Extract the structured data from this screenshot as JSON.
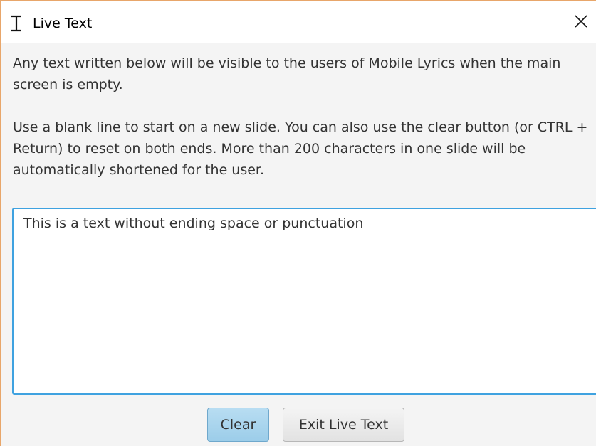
{
  "window": {
    "title": "Live Text",
    "icon": "text-cursor-icon",
    "close_icon": "close-icon"
  },
  "description": {
    "paragraph1": "Any text written below will be visible to the users of Mobile Lyrics when the main screen is empty.",
    "paragraph2": "Use a blank line to start on a new slide. You can also use the clear button (or CTRL + Return) to reset on both ends. More than 200 characters in one slide will be automatically shortened for the user."
  },
  "editor": {
    "value": "This is a text without ending space or punctuation"
  },
  "buttons": {
    "clear_label": "Clear",
    "exit_label": "Exit Live Text"
  },
  "colors": {
    "accent_border": "#3fa2e0",
    "clear_button_bg": "#a9d5ee",
    "window_border": "#e8a66a"
  }
}
